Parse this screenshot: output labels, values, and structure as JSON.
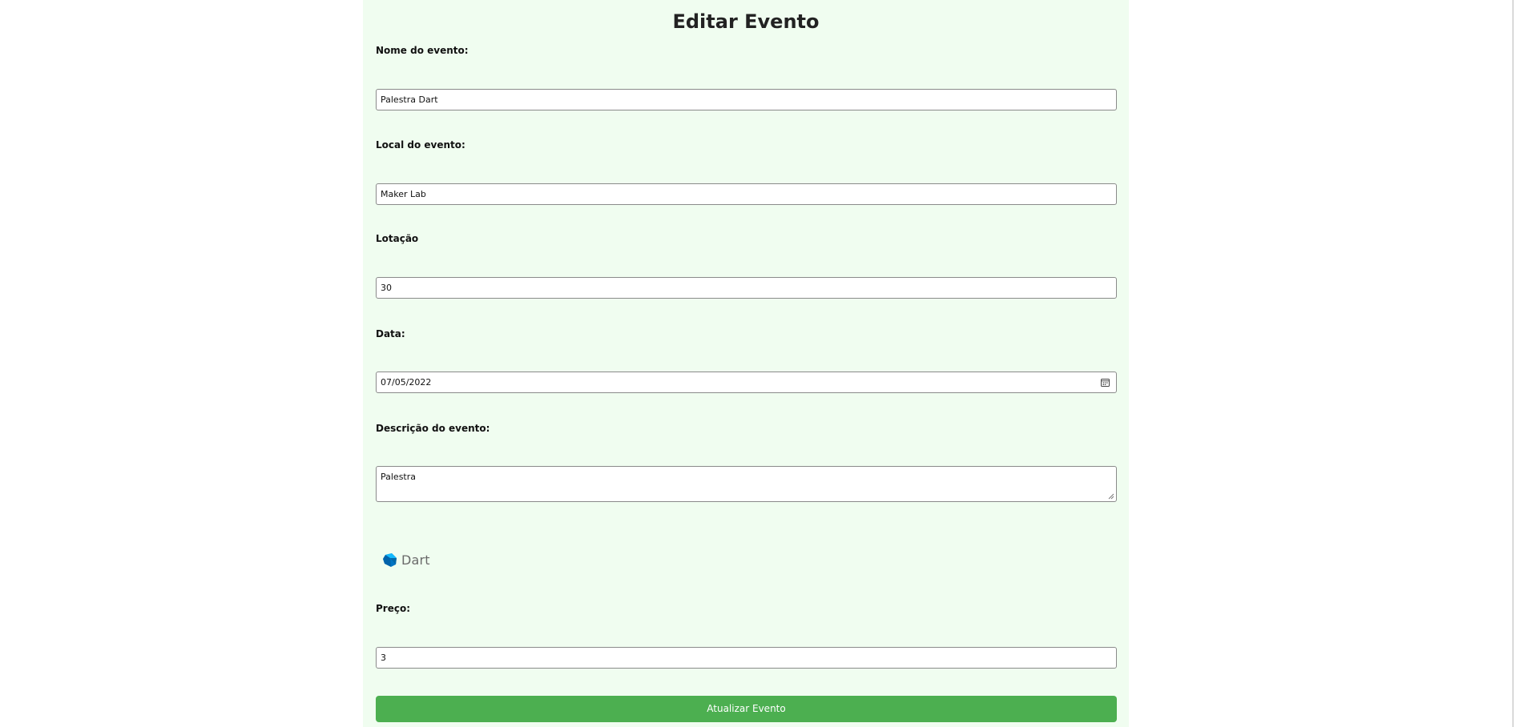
{
  "form": {
    "title": "Editar Evento",
    "nome_label": "Nome do evento:",
    "nome_value": "Palestra Dart",
    "local_label": "Local do evento:",
    "local_value": "Maker Lab",
    "lotacao_label": "Lotação",
    "lotacao_value": "30",
    "data_label": "Data:",
    "data_value": "07/05/2022",
    "descricao_label": "Descrição do evento:",
    "descricao_value": "Palestra",
    "logo_text": "Dart",
    "preco_label": "Preço:",
    "preco_value": "3",
    "submit_label": "Atualizar Evento"
  },
  "icons": {
    "calendar": "calendar-icon",
    "logo": "dart-logo-icon"
  },
  "colors": {
    "background": "#ffffff",
    "form_background": "#f0fdf0",
    "button": "#4caf50",
    "dart_blue": "#0175c2",
    "dart_light": "#13b9fd"
  }
}
